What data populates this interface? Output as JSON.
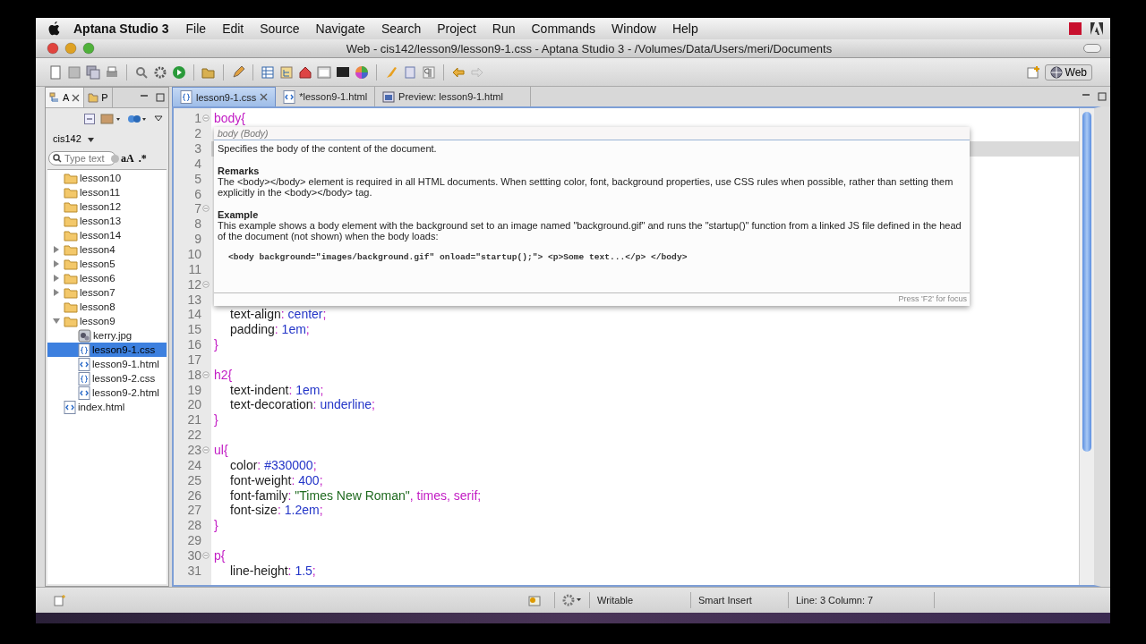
{
  "menu_bar": {
    "app_name": "Aptana Studio 3",
    "items": [
      "File",
      "Edit",
      "Source",
      "Navigate",
      "Search",
      "Project",
      "Run",
      "Commands",
      "Window",
      "Help"
    ]
  },
  "window": {
    "title": "Web - cis142/lesson9/lesson9-1.css - Aptana Studio 3 - /Volumes/Data/Users/meri/Documents"
  },
  "toolbar": {
    "perspective": "Web"
  },
  "project_pane": {
    "tabs": [
      {
        "label": "A",
        "selected": true
      },
      {
        "label": "P",
        "selected": false
      }
    ],
    "project": "cis142",
    "search": {
      "placeholder": "Type text"
    },
    "case_toggle": "aA",
    "regex_toggle": ".*",
    "tree": [
      {
        "label": "lesson10",
        "kind": "folder",
        "selected": false
      },
      {
        "label": "lesson11",
        "kind": "folder",
        "selected": false
      },
      {
        "label": "lesson12",
        "kind": "folder",
        "selected": false
      },
      {
        "label": "lesson13",
        "kind": "folder",
        "selected": false
      },
      {
        "label": "lesson14",
        "kind": "folder",
        "selected": false
      },
      {
        "label": "lesson4",
        "kind": "folder",
        "selected": false,
        "expanded": false
      },
      {
        "label": "lesson5",
        "kind": "folder",
        "selected": false,
        "expanded": false
      },
      {
        "label": "lesson6",
        "kind": "folder",
        "selected": false,
        "expanded": false
      },
      {
        "label": "lesson7",
        "kind": "folder",
        "selected": false,
        "expanded": false
      },
      {
        "label": "lesson8",
        "kind": "folder",
        "selected": false
      },
      {
        "label": "lesson9",
        "kind": "folder",
        "selected": false,
        "expanded": true,
        "children": [
          {
            "label": "kerry.jpg",
            "kind": "image",
            "selected": false
          },
          {
            "label": "lesson9-1.css",
            "kind": "css",
            "selected": true
          },
          {
            "label": "lesson9-1.html",
            "kind": "html",
            "selected": false
          },
          {
            "label": "lesson9-2.css",
            "kind": "css",
            "selected": false
          },
          {
            "label": "lesson9-2.html",
            "kind": "html",
            "selected": false
          }
        ]
      },
      {
        "label": "index.html",
        "kind": "html",
        "selected": false
      }
    ]
  },
  "editor": {
    "tabs": [
      {
        "label": "lesson9-1.css",
        "kind": "css",
        "selected": true
      },
      {
        "label": "*lesson9-1.html",
        "kind": "html",
        "selected": false
      },
      {
        "label": "Preview: lesson9-1.html",
        "kind": "preview",
        "selected": false
      }
    ],
    "lines": [
      {
        "number": "1",
        "fold": true,
        "current": false,
        "tokens": [
          {
            "kind": "selector",
            "text": "body"
          },
          {
            "kind": "punct",
            "text": "{"
          }
        ]
      },
      {
        "number": "2",
        "fold": false,
        "current": false
      },
      {
        "number": "3",
        "fold": false,
        "current": true
      },
      {
        "number": "4",
        "fold": false,
        "current": false
      },
      {
        "number": "5",
        "fold": false,
        "current": false
      },
      {
        "number": "6",
        "fold": false,
        "current": false
      },
      {
        "number": "7",
        "fold": true,
        "current": false
      },
      {
        "number": "8",
        "fold": false,
        "current": false
      },
      {
        "number": "9",
        "fold": false,
        "current": false
      },
      {
        "number": "10",
        "fold": false,
        "current": false
      },
      {
        "number": "11",
        "fold": false,
        "current": false
      },
      {
        "number": "12",
        "fold": true,
        "current": false
      },
      {
        "number": "13",
        "fold": false,
        "current": false
      },
      {
        "number": "14",
        "fold": false,
        "current": false,
        "tokens": [
          {
            "kind": "property",
            "text": "text-align"
          },
          {
            "kind": "punct",
            "text": ": "
          },
          {
            "kind": "value",
            "text": "center"
          },
          {
            "kind": "punct",
            "text": ";"
          }
        ]
      },
      {
        "number": "15",
        "fold": false,
        "current": false,
        "tokens": [
          {
            "kind": "property",
            "text": "padding"
          },
          {
            "kind": "punct",
            "text": ": "
          },
          {
            "kind": "value",
            "text": "1em"
          },
          {
            "kind": "punct",
            "text": ";"
          }
        ]
      },
      {
        "number": "16",
        "fold": false,
        "current": false,
        "tokens": [
          {
            "kind": "punct",
            "text": "}"
          }
        ]
      },
      {
        "number": "17",
        "fold": false,
        "current": false
      },
      {
        "number": "18",
        "fold": true,
        "current": false,
        "tokens": [
          {
            "kind": "selector",
            "text": "h2"
          },
          {
            "kind": "punct",
            "text": "{"
          }
        ]
      },
      {
        "number": "19",
        "fold": false,
        "current": false,
        "tokens": [
          {
            "kind": "property",
            "text": "text-indent"
          },
          {
            "kind": "punct",
            "text": ": "
          },
          {
            "kind": "value",
            "text": "1em"
          },
          {
            "kind": "punct",
            "text": ";"
          }
        ]
      },
      {
        "number": "20",
        "fold": false,
        "current": false,
        "tokens": [
          {
            "kind": "property",
            "text": "text-decoration"
          },
          {
            "kind": "punct",
            "text": ": "
          },
          {
            "kind": "value",
            "text": "underline"
          },
          {
            "kind": "punct",
            "text": ";"
          }
        ]
      },
      {
        "number": "21",
        "fold": false,
        "current": false,
        "tokens": [
          {
            "kind": "punct",
            "text": "}"
          }
        ]
      },
      {
        "number": "22",
        "fold": false,
        "current": false
      },
      {
        "number": "23",
        "fold": true,
        "current": false,
        "tokens": [
          {
            "kind": "selector",
            "text": "ul"
          },
          {
            "kind": "punct",
            "text": "{"
          }
        ]
      },
      {
        "number": "24",
        "fold": false,
        "current": false,
        "tokens": [
          {
            "kind": "property",
            "text": "color"
          },
          {
            "kind": "punct",
            "text": ": "
          },
          {
            "kind": "value",
            "text": "#330000"
          },
          {
            "kind": "punct",
            "text": ";"
          }
        ]
      },
      {
        "number": "25",
        "fold": false,
        "current": false,
        "tokens": [
          {
            "kind": "property",
            "text": "font-weight"
          },
          {
            "kind": "punct",
            "text": ": "
          },
          {
            "kind": "value",
            "text": "400"
          },
          {
            "kind": "punct",
            "text": ";"
          }
        ]
      },
      {
        "number": "26",
        "fold": false,
        "current": false,
        "tokens": [
          {
            "kind": "property",
            "text": "font-family"
          },
          {
            "kind": "punct",
            "text": ": "
          },
          {
            "kind": "string",
            "text": "\"Times New Roman\""
          },
          {
            "kind": "keyword",
            "text": ", times, serif;"
          }
        ]
      },
      {
        "number": "27",
        "fold": false,
        "current": false,
        "tokens": [
          {
            "kind": "property",
            "text": "font-size"
          },
          {
            "kind": "punct",
            "text": ": "
          },
          {
            "kind": "value",
            "text": "1.2em"
          },
          {
            "kind": "punct",
            "text": ";"
          }
        ]
      },
      {
        "number": "28",
        "fold": false,
        "current": false,
        "tokens": [
          {
            "kind": "punct",
            "text": "}"
          }
        ]
      },
      {
        "number": "29",
        "fold": false,
        "current": false
      },
      {
        "number": "30",
        "fold": true,
        "current": false,
        "tokens": [
          {
            "kind": "selector",
            "text": "p"
          },
          {
            "kind": "punct",
            "text": "{"
          }
        ]
      },
      {
        "number": "31",
        "fold": false,
        "current": false,
        "tokens": [
          {
            "kind": "property",
            "text": "line-height"
          },
          {
            "kind": "punct",
            "text": ": "
          },
          {
            "kind": "value",
            "text": "1.5"
          },
          {
            "kind": "punct",
            "text": ";"
          }
        ]
      }
    ],
    "tooltip": {
      "title": "body (Body)",
      "summary": "Specifies the body of the content of the document.",
      "sections": [
        {
          "heading": "Remarks",
          "text": "The <body></body> element is required in all HTML documents. When settting color, font, background properties, use CSS rules when possible, rather than setting them explicitly in the <body></body> tag."
        },
        {
          "heading": "Example",
          "text": "This example shows a body element with the background set to an image named \"background.gif\" and runs the \"startup()\" function from a linked JS file defined in the head of the document (not shown) when the body loads:",
          "code": "<body background=\"images/background.gif\" onload=\"startup();\"> <p>Some text...</p> </body>"
        }
      ],
      "footer": "Press 'F2' for focus"
    }
  },
  "status_bar": {
    "mode": "Writable",
    "insert_mode": "Smart Insert",
    "position": "Line: 3 Column: 7"
  }
}
